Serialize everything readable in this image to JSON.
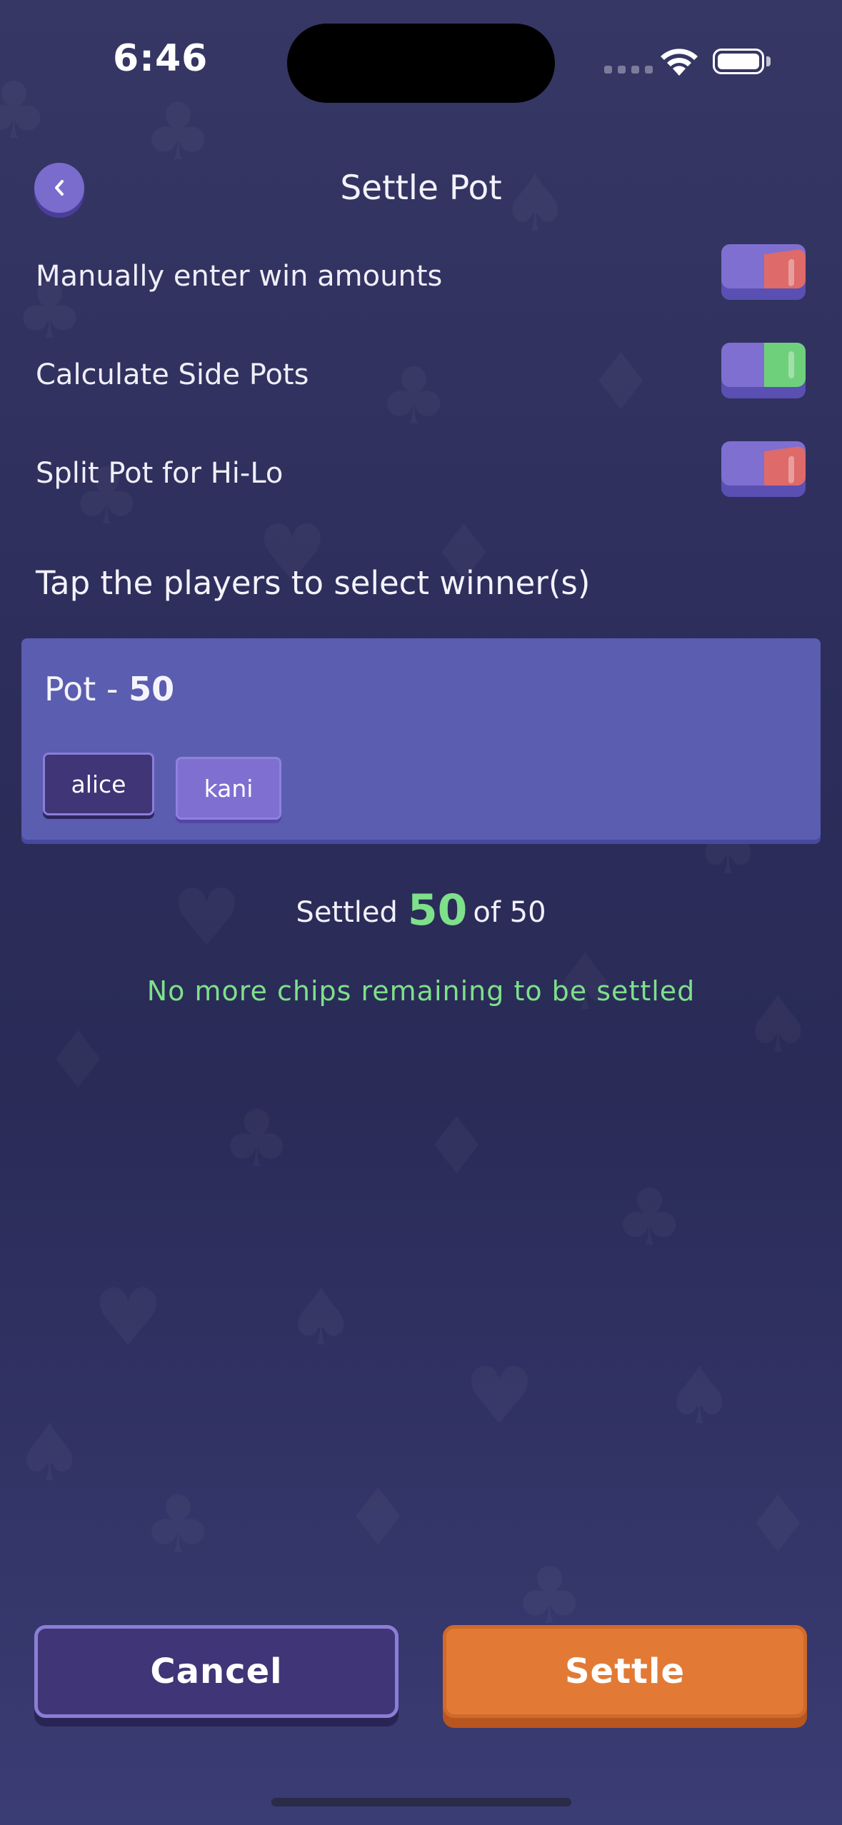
{
  "status_bar": {
    "time": "6:46"
  },
  "header": {
    "title": "Settle Pot"
  },
  "settings": [
    {
      "label": "Manually enter win amounts",
      "enabled": false
    },
    {
      "label": "Calculate Side Pots",
      "enabled": true
    },
    {
      "label": "Split Pot for Hi-Lo",
      "enabled": false
    }
  ],
  "instruction": "Tap the players to select winner(s)",
  "pot": {
    "label": "Pot - ",
    "amount": "50",
    "players": [
      "alice",
      "kani"
    ]
  },
  "summary": {
    "prefix": "Settled",
    "settled_amount": "50",
    "of_text": "of 50",
    "remaining_message": "No more chips remaining to be settled"
  },
  "buttons": {
    "cancel": "Cancel",
    "settle": "Settle"
  },
  "colors": {
    "accent_green": "#7ee08a",
    "settle_orange": "#e27a35",
    "toggle_off": "#de6a6a",
    "toggle_on": "#6fd07c"
  }
}
